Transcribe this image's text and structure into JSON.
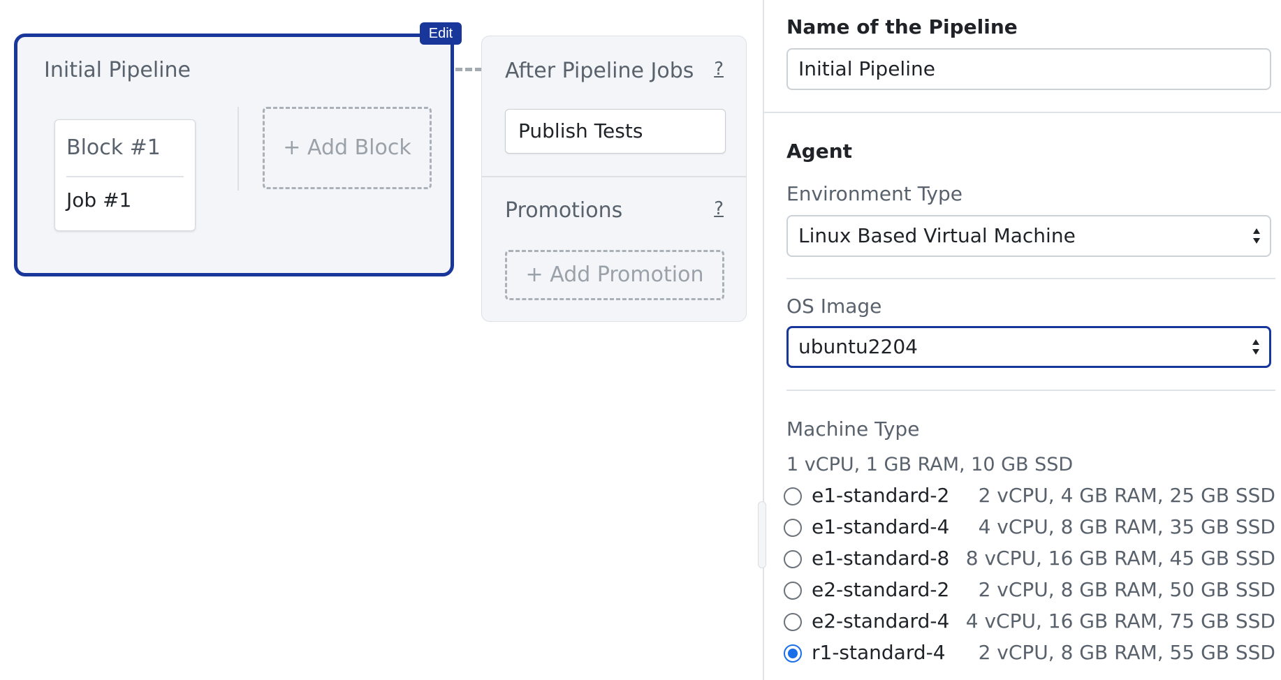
{
  "canvas": {
    "pipeline": {
      "edit_label": "Edit",
      "title": "Initial Pipeline",
      "block": {
        "title": "Block #1",
        "job": "Job #1"
      },
      "add_block_label": "+ Add Block"
    },
    "after_pipeline": {
      "title": "After Pipeline Jobs",
      "help": "?",
      "job": "Publish Tests"
    },
    "promotions": {
      "title": "Promotions",
      "help": "?",
      "add_label": "+ Add Promotion"
    }
  },
  "panel": {
    "name_label": "Name of the Pipeline",
    "name_value": "Initial Pipeline",
    "agent_label": "Agent",
    "env_label": "Environment Type",
    "env_value": "Linux Based Virtual Machine",
    "os_label": "OS Image",
    "os_value": "ubuntu2204",
    "machine_label": "Machine Type",
    "machine_default": "1 vCPU, 1 GB RAM, 10 GB SSD",
    "machines": [
      {
        "name": "e1-standard-2",
        "spec": "2 vCPU, 4 GB RAM, 25 GB SSD",
        "checked": false
      },
      {
        "name": "e1-standard-4",
        "spec": "4 vCPU, 8 GB RAM, 35 GB SSD",
        "checked": false
      },
      {
        "name": "e1-standard-8",
        "spec": "8 vCPU, 16 GB RAM, 45 GB SSD",
        "checked": false
      },
      {
        "name": "e2-standard-2",
        "spec": "2 vCPU, 8 GB RAM, 50 GB SSD",
        "checked": false
      },
      {
        "name": "e2-standard-4",
        "spec": "4 vCPU, 16 GB RAM, 75 GB SSD",
        "checked": false
      },
      {
        "name": "r1-standard-4",
        "spec": "2 vCPU, 8 GB RAM, 55 GB SSD",
        "checked": true
      }
    ]
  },
  "colors": {
    "accent": "#19379b",
    "radio_checked": "#1a6fe8",
    "canvas_bg": "#f3f5f8"
  }
}
